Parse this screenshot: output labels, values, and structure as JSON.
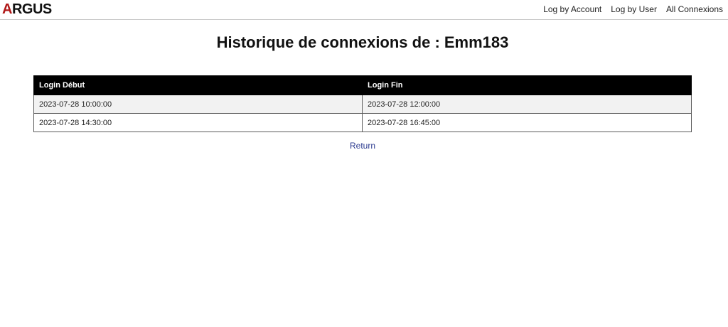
{
  "header": {
    "logo_first": "A",
    "logo_rest": "RGUS",
    "nav": {
      "log_by_account": "Log by Account",
      "log_by_user": "Log by User",
      "all_connexions": "All Connexions"
    }
  },
  "main": {
    "title": "Historique de connexions de : Emm183",
    "table": {
      "columns": [
        "Login Début",
        "Login Fin"
      ],
      "rows": [
        [
          "2023-07-28 10:00:00",
          "2023-07-28 12:00:00"
        ],
        [
          "2023-07-28 14:30:00",
          "2023-07-28 16:45:00"
        ]
      ]
    },
    "return_label": "Return"
  },
  "colors": {
    "logo_accent": "#b01818",
    "table_header_bg": "#000000",
    "link": "#2b3a8f"
  }
}
